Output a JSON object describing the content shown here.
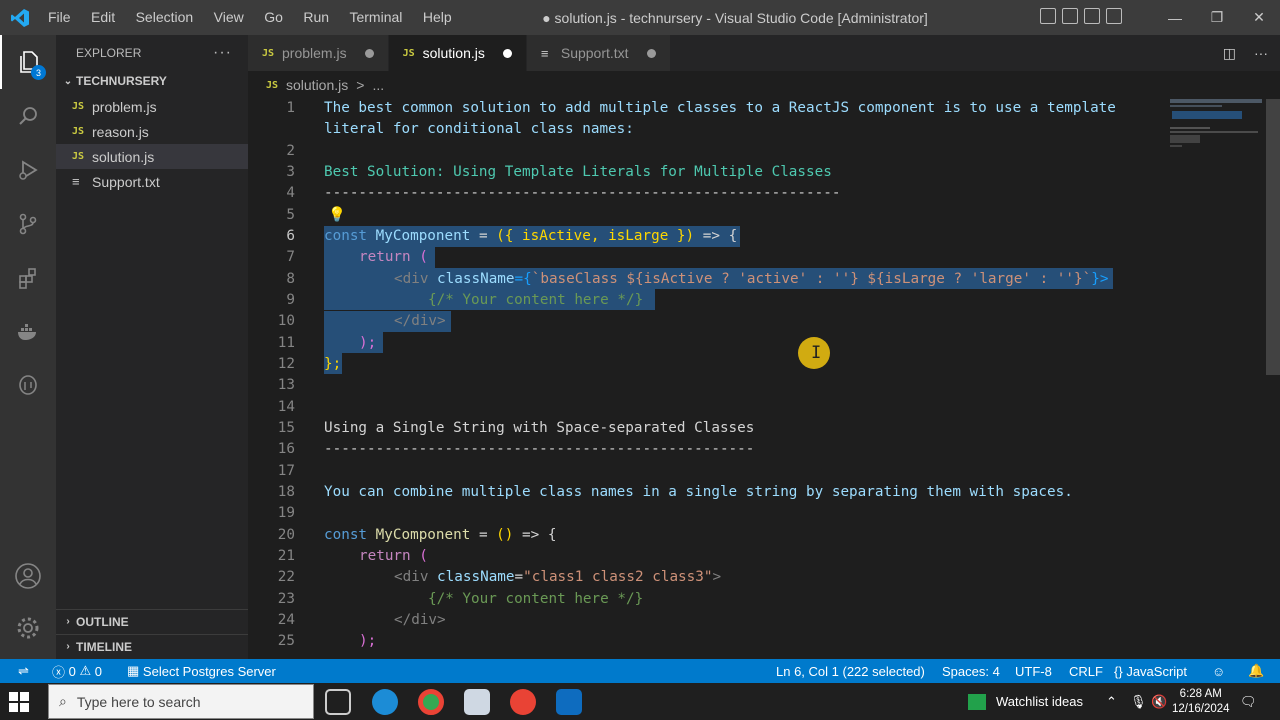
{
  "titlebar": {
    "menu": [
      "File",
      "Edit",
      "Selection",
      "View",
      "Go",
      "Run",
      "Terminal",
      "Help"
    ],
    "title": "● solution.js - technursery - Visual Studio Code [Administrator]"
  },
  "activity": {
    "explorer_badge": "3"
  },
  "sidebar": {
    "header": "EXPLORER",
    "folder": "TECHNURSERY",
    "files": [
      {
        "icon": "JS",
        "name": "problem.js"
      },
      {
        "icon": "JS",
        "name": "reason.js"
      },
      {
        "icon": "JS",
        "name": "solution.js"
      },
      {
        "icon": "≡",
        "name": "Support.txt"
      }
    ],
    "outline": "OUTLINE",
    "timeline": "TIMELINE"
  },
  "tabs": [
    {
      "icon": "JS",
      "label": "problem.js"
    },
    {
      "icon": "JS",
      "label": "solution.js"
    },
    {
      "icon": "≡",
      "label": "Support.txt"
    }
  ],
  "breadcrumb": {
    "icon": "JS",
    "file": "solution.js",
    "sep": ">",
    "rest": "..."
  },
  "editor": {
    "line_numbers": [
      "1",
      "2",
      "3",
      "4",
      "5",
      "6",
      "7",
      "8",
      "9",
      "10",
      "11",
      "12",
      "13",
      "14",
      "15",
      "16",
      "17",
      "18",
      "19",
      "20",
      "21",
      "22",
      "23",
      "24",
      "25"
    ],
    "line1a": "The best common solution to add multiple classes to a ReactJS component is to use a template",
    "line1b": "literal for conditional class names:",
    "line3": "Best Solution: Using Template Literals for Multiple Classes",
    "line4": "------------------------------------------------------------",
    "line15": "Using a Single String with Space-separated Classes",
    "line16": "--------------------------------------------------",
    "line18": "You can combine multiple class names in a single string by separating them with spaces.",
    "code": {
      "const": "const",
      "MyComponent": "MyComponent",
      "eq": " = ",
      "args": "({ isActive, isLarge })",
      "arrow": " => {",
      "return": "return",
      "paren_open": " (",
      "div_open": "<div",
      "className": " className",
      "eqbrace": "={",
      "template": "`baseClass ${isActive ? 'active' : ''} ${isLarge ? 'large' : ''}`",
      "close_tag": "}>",
      "comment": "{/* Your content here */}",
      "div_close": "</div>",
      "paren_close": ");",
      "brace_close": "};",
      "args2": "()",
      "class_str": "\"class1 class2 class3\"",
      "gt": ">"
    }
  },
  "statusbar": {
    "errors": "0",
    "warnings": "0",
    "postgres": "Select Postgres Server",
    "position": "Ln 6, Col 1 (222 selected)",
    "spaces": "Spaces: 4",
    "encoding": "UTF-8",
    "eol": "CRLF",
    "language": "JavaScript"
  },
  "taskbar": {
    "search_placeholder": "Type here to search",
    "watchlist": "Watchlist ideas",
    "time": "6:28 AM",
    "date": "12/16/2024"
  }
}
